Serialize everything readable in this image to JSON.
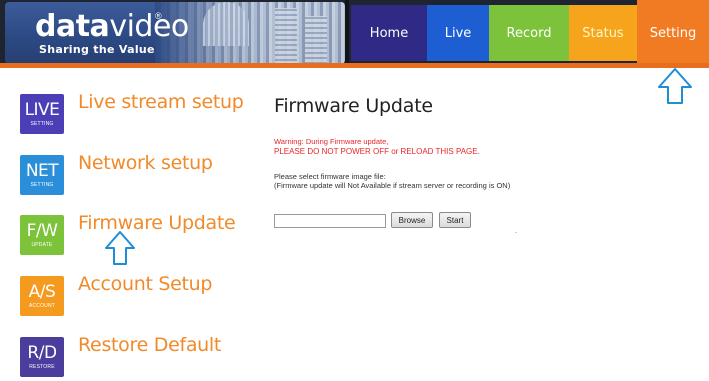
{
  "header": {
    "brand_name_a": "data",
    "brand_name_b": "video",
    "brand_registered": "®",
    "brand_tagline": "Sharing the Value",
    "nav": [
      {
        "label": "Home",
        "color": "#2f2a86"
      },
      {
        "label": "Live",
        "color": "#1d5fd3"
      },
      {
        "label": "Record",
        "color": "#7cc23a"
      },
      {
        "label": "Status",
        "color": "#f7a41d"
      },
      {
        "label": "Setting",
        "color": "#f07b23",
        "active": true
      }
    ]
  },
  "sidebar": {
    "items": [
      {
        "icon_big": "LIVE",
        "icon_small": "SETTING",
        "label": "Live stream setup",
        "icon_color": "#4b3fb8"
      },
      {
        "icon_big": "NET",
        "icon_small": "SETTING",
        "label": "Network setup",
        "icon_color": "#2a8fd8"
      },
      {
        "icon_big": "F/W",
        "icon_small": "UPDATE",
        "label": "Firmware Update",
        "icon_color": "#7cc23a",
        "active": true
      },
      {
        "icon_big": "A/S",
        "icon_small": "ACCOUNT",
        "label": "Account Setup",
        "icon_color": "#f49a1f"
      },
      {
        "icon_big": "R/D",
        "icon_small": "RESTORE",
        "label": "Restore Default",
        "icon_color": "#4a3d9e"
      }
    ]
  },
  "main": {
    "title": "Firmware Update",
    "warning_line1": "Warning: During Firmware update,",
    "warning_line2": "PLEASE DO NOT POWER OFF or RELOAD THIS PAGE.",
    "info_line1": "Please select firmware image file:",
    "info_line2": "(Firmware update will Not Available if stream server or recording is ON)",
    "browse_label": "Browse",
    "start_label": "Start"
  },
  "colors": {
    "accent_orange": "#f08a2a",
    "warning_red": "#e8262b",
    "arrow_blue": "#1e8fd6"
  }
}
